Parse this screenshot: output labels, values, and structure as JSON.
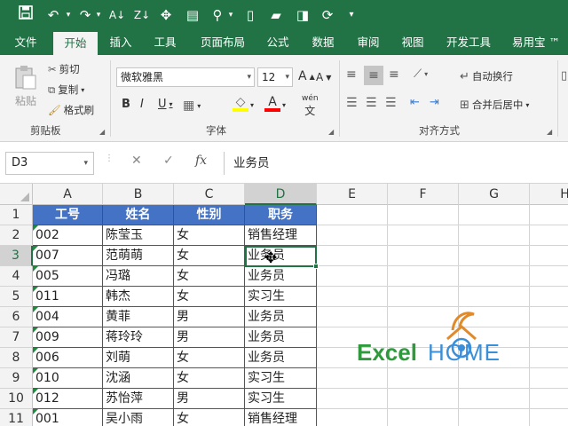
{
  "qat": {
    "icons": [
      "save-icon",
      "undo-icon",
      "redo-icon",
      "sort-icon",
      "filter-icon",
      "freeze-icon",
      "form-icon",
      "find-icon",
      "new-file-icon",
      "open-folder-icon",
      "save-as-icon",
      "refresh-icon",
      "customize-icon"
    ]
  },
  "tabs": [
    "文件",
    "开始",
    "插入",
    "工具",
    "页面布局",
    "公式",
    "数据",
    "审阅",
    "视图",
    "开发工具",
    "易用宝 ™"
  ],
  "ribbon": {
    "clipboard": {
      "paste": "粘贴",
      "cut": "剪切",
      "copy": "复制",
      "format_painter": "格式刷",
      "label": "剪贴板"
    },
    "font": {
      "name": "微软雅黑",
      "size": "12",
      "label": "字体",
      "bold": "B",
      "italic": "I",
      "underline": "U",
      "grow": "A",
      "shrink": "A",
      "phonetic": "wén"
    },
    "align": {
      "wrap": "自动换行",
      "merge": "合并后居中",
      "label": "对齐方式"
    },
    "fill_color": "#ffff00",
    "font_color": "#ff0000"
  },
  "formula_bar": {
    "name_box": "D3",
    "fx": "fx",
    "value": "业务员"
  },
  "columns": [
    "A",
    "B",
    "C",
    "D",
    "E",
    "F",
    "G",
    "H"
  ],
  "rows": [
    "1",
    "2",
    "3",
    "4",
    "5",
    "6",
    "7",
    "8",
    "9",
    "10",
    "11"
  ],
  "table": {
    "headers": [
      "工号",
      "姓名",
      "性别",
      "职务"
    ],
    "data": [
      [
        "002",
        "陈莹玉",
        "女",
        "销售经理"
      ],
      [
        "007",
        "范萌萌",
        "女",
        "业务员"
      ],
      [
        "005",
        "冯璐",
        "女",
        "业务员"
      ],
      [
        "011",
        "韩杰",
        "女",
        "实习生"
      ],
      [
        "004",
        "黄菲",
        "男",
        "业务员"
      ],
      [
        "009",
        "蒋玲玲",
        "男",
        "业务员"
      ],
      [
        "006",
        "刘萌",
        "女",
        "业务员"
      ],
      [
        "010",
        "沈涵",
        "女",
        "实习生"
      ],
      [
        "012",
        "苏怡萍",
        "男",
        "实习生"
      ],
      [
        "001",
        "吴小雨",
        "女",
        "销售经理"
      ]
    ]
  },
  "logo": {
    "excel": "Excel",
    "home": "HOME"
  },
  "colors": {
    "brand": "#217346",
    "header_fill": "#4472c4",
    "logo_green": "#2e9a3c",
    "logo_blue": "#3b8ed8",
    "logo_orange": "#e08a2a"
  }
}
